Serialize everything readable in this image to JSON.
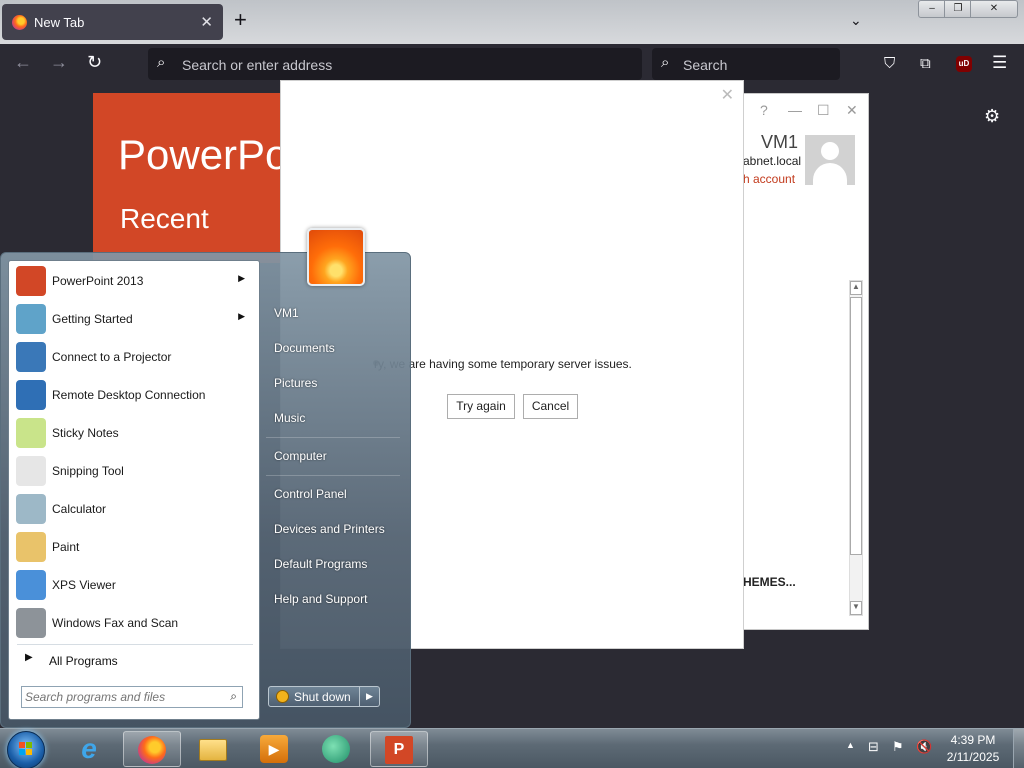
{
  "browser": {
    "tab_title": "New Tab",
    "tab_close": "✕",
    "new_tab": "+",
    "tab_list": "⌄",
    "window_controls": {
      "minimize": "–",
      "maximize": "❐",
      "close": "✕"
    },
    "nav": {
      "back": "←",
      "forward": "→",
      "reload": "↻"
    },
    "url_placeholder": "Search or enter address",
    "search_placeholder": "Search",
    "toolbar_icons": [
      "pocket-icon",
      "extensions-icon",
      "ublock-origin-icon",
      "hamburger-menu-icon"
    ],
    "ublock_label": "uD",
    "settings_icon": "⚙"
  },
  "powerpoint": {
    "brand": "PowerPoint",
    "recent": "Recent",
    "controls": {
      "help": "?",
      "minimize": "—",
      "maximize": "☐",
      "close": "✕"
    },
    "user_name": "VM1",
    "domain": "abnet.local",
    "switch_account": "h account",
    "themes": "HEMES..."
  },
  "dialog": {
    "close": "✕",
    "message": "ry, we are having some temporary server issues.",
    "try_again": "Try again",
    "cancel": "Cancel"
  },
  "start_menu": {
    "programs": [
      {
        "label": "PowerPoint 2013",
        "icon": "powerpoint-icon",
        "submenu": true,
        "color": "#d24726"
      },
      {
        "label": "Getting Started",
        "icon": "getting-started-icon",
        "submenu": true,
        "color": "#5fa3c9"
      },
      {
        "label": "Connect to a Projector",
        "icon": "projector-icon",
        "submenu": false,
        "color": "#3a78b8"
      },
      {
        "label": "Remote Desktop Connection",
        "icon": "remote-desktop-icon",
        "submenu": false,
        "color": "#2f6fb5"
      },
      {
        "label": "Sticky Notes",
        "icon": "sticky-notes-icon",
        "submenu": false,
        "color": "#c9e48a"
      },
      {
        "label": "Snipping Tool",
        "icon": "snipping-tool-icon",
        "submenu": false,
        "color": "#e6e6e6"
      },
      {
        "label": "Calculator",
        "icon": "calculator-icon",
        "submenu": false,
        "color": "#9db8c7"
      },
      {
        "label": "Paint",
        "icon": "paint-icon",
        "submenu": false,
        "color": "#e9c36a"
      },
      {
        "label": "XPS Viewer",
        "icon": "xps-viewer-icon",
        "submenu": false,
        "color": "#4a90d9"
      },
      {
        "label": "Windows Fax and Scan",
        "icon": "fax-scan-icon",
        "submenu": false,
        "color": "#8d9399"
      }
    ],
    "all_programs": "All Programs",
    "search_placeholder": "Search programs and files",
    "right_items": [
      "VM1",
      "Documents",
      "Pictures",
      "Music",
      "Computer",
      "Control Panel",
      "Devices and Printers",
      "Default Programs",
      "Help and Support"
    ],
    "shutdown": "Shut down"
  },
  "taskbar": {
    "apps": [
      "internet-explorer-icon",
      "firefox-icon",
      "file-explorer-icon",
      "windows-media-player-icon",
      "cortana-like-icon",
      "powerpoint-icon"
    ],
    "tray_icons": [
      "network-icon",
      "action-center-flag-icon",
      "volume-muted-icon"
    ],
    "time": "4:39 PM",
    "date": "2/11/2025"
  }
}
